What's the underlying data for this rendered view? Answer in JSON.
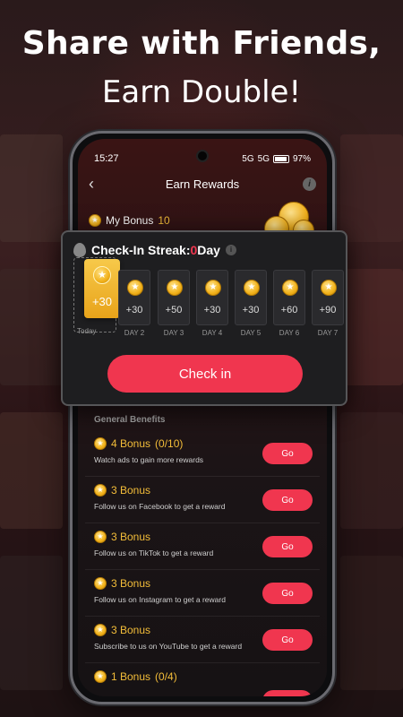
{
  "headline": {
    "line1": "Share with Friends,",
    "line2": "Earn Double!"
  },
  "status": {
    "time": "15:27",
    "battery": "97%",
    "signal1": "5G",
    "signal2": "5G"
  },
  "header": {
    "title": "Earn Rewards"
  },
  "my_bonus": {
    "label": "My Bonus",
    "value": "10"
  },
  "checkin": {
    "title_prefix": "Check-In Streak: ",
    "streak": "0",
    "unit": " Day",
    "today": {
      "label": "Today",
      "amount": "+30"
    },
    "days": [
      {
        "label": "DAY 2",
        "amount": "+30"
      },
      {
        "label": "DAY 3",
        "amount": "+50"
      },
      {
        "label": "DAY 4",
        "amount": "+30"
      },
      {
        "label": "DAY 5",
        "amount": "+30"
      },
      {
        "label": "DAY 6",
        "amount": "+60"
      },
      {
        "label": "DAY 7",
        "amount": "+90"
      }
    ],
    "button": "Check in"
  },
  "benefits": {
    "heading": "General Benefits",
    "items": [
      {
        "bonus": "4 Bonus",
        "progress": "(0/10)",
        "desc": "Watch ads to gain more rewards",
        "button": "Go"
      },
      {
        "bonus": "3 Bonus",
        "progress": "",
        "desc": "Follow us on Facebook to get a reward",
        "button": "Go"
      },
      {
        "bonus": "3 Bonus",
        "progress": "",
        "desc": "Follow us on TikTok to get a reward",
        "button": "Go"
      },
      {
        "bonus": "3 Bonus",
        "progress": "",
        "desc": "Follow us on Instagram to get a reward",
        "button": "Go"
      },
      {
        "bonus": "3 Bonus",
        "progress": "",
        "desc": "Subscribe to us on YouTube to get a reward",
        "button": "Go"
      },
      {
        "bonus": "1 Bonus",
        "progress": "(0/4)",
        "desc": "",
        "button": ""
      }
    ]
  },
  "colors": {
    "accent": "#f0364f",
    "gold": "#f3bd39"
  }
}
